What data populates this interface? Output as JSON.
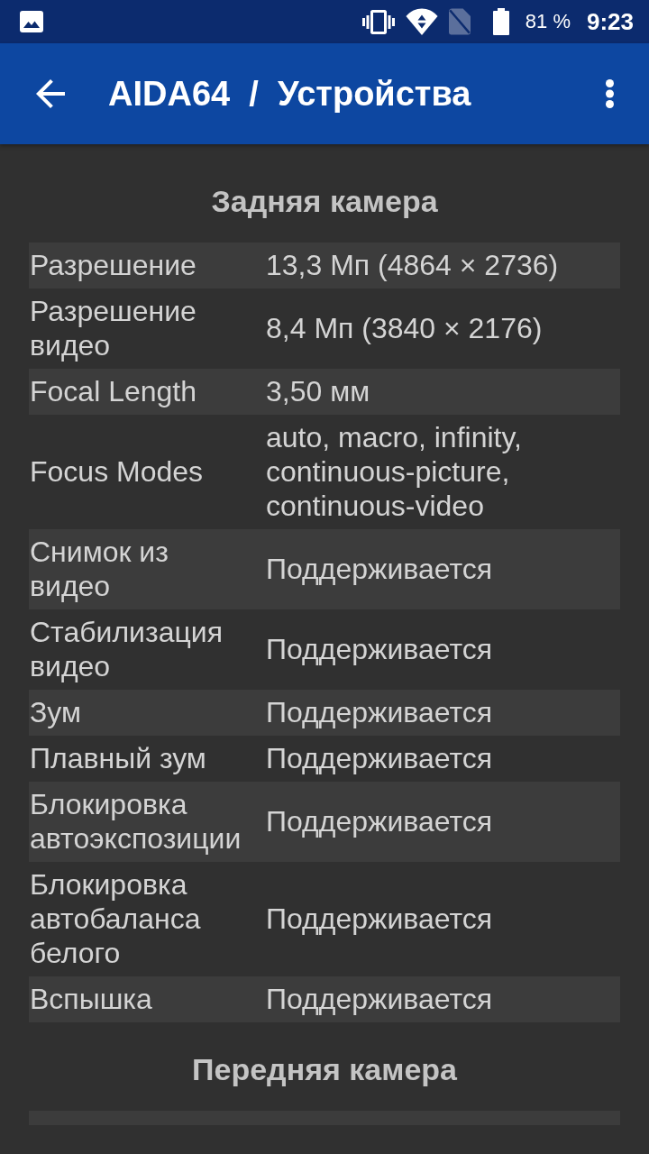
{
  "status_bar": {
    "battery": "81 %",
    "time": "9:23"
  },
  "app_bar": {
    "title": "AIDA64  /  Устройства"
  },
  "sections": [
    {
      "title": "Задняя камера",
      "rows": [
        {
          "label": "Разрешение",
          "value": "13,3 Мп (4864 × 2736)"
        },
        {
          "label": "Разрешение видео",
          "value": "8,4 Мп (3840 × 2176)"
        },
        {
          "label": "Focal Length",
          "value": "3,50 мм"
        },
        {
          "label": "Focus Modes",
          "value": "auto, macro, infinity, continuous-picture, continuous-video"
        },
        {
          "label": "Снимок из видео",
          "value": "Поддерживается"
        },
        {
          "label": "Стабилизация видео",
          "value": "Поддерживается"
        },
        {
          "label": "Зум",
          "value": "Поддерживается"
        },
        {
          "label": "Плавный зум",
          "value": "Поддерживается"
        },
        {
          "label": "Блокировка автоэкспозиции",
          "value": "Поддерживается"
        },
        {
          "label": "Блокировка автобаланса белого",
          "value": "Поддерживается"
        },
        {
          "label": "Вспышка",
          "value": "Поддерживается"
        }
      ]
    },
    {
      "title": "Передняя камера",
      "more_below": true
    }
  ]
}
